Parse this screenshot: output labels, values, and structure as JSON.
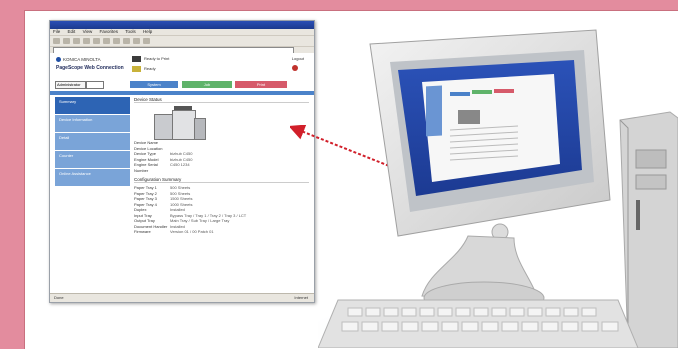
{
  "browser": {
    "window_title": "",
    "menu_items": [
      "File",
      "Edit",
      "View",
      "Favorites",
      "Tools",
      "Help"
    ],
    "address": "",
    "status_left": "Done",
    "status_right": "Internet"
  },
  "header": {
    "brand": "KONICA MINOLTA",
    "product": "PageScope Web Connection",
    "device_label_1": "Ready to Print",
    "device_label_2": "Ready",
    "top_right": "Logout"
  },
  "tabs": {
    "mode_select": "Administrator",
    "tab1": "System",
    "tab2": "Job",
    "tab3": "Print"
  },
  "sidebar": {
    "items": [
      {
        "label": "Summary"
      },
      {
        "label": "Device Information"
      },
      {
        "label": "Detail"
      },
      {
        "label": "Counter"
      },
      {
        "label": "Online Assistance"
      }
    ]
  },
  "main": {
    "title": "Device Status",
    "device_info": [
      {
        "k": "Device Name",
        "v": ""
      },
      {
        "k": "Device Location",
        "v": ""
      },
      {
        "k": "Device Type",
        "v": "bizhub C450"
      },
      {
        "k": "Engine Model",
        "v": "bizhub C450"
      },
      {
        "k": "Engine Serial Number",
        "v": "C450 1234"
      }
    ],
    "config_title": "Configuration Summary",
    "config": [
      {
        "k": "Paper Tray 1",
        "v": "500 Sheets"
      },
      {
        "k": "Paper Tray 2",
        "v": "500 Sheets"
      },
      {
        "k": "Paper Tray 3",
        "v": "1500 Sheets"
      },
      {
        "k": "Paper Tray 4",
        "v": "1000 Sheets"
      },
      {
        "k": "Duplex",
        "v": "Installed"
      },
      {
        "k": "Input Tray",
        "v": "Bypass Tray / Tray 1 / Tray 2 / Tray 3 / LCT"
      },
      {
        "k": "Output Tray",
        "v": "Main Tray / Sub Tray / Large Tray"
      },
      {
        "k": "Document Handler",
        "v": "Installed"
      },
      {
        "k": "Firmware",
        "v": "Version 01 / 00 Patch 01"
      }
    ]
  },
  "colors": {
    "frame_pink": "#e38c9e",
    "tab_blue": "#4b82c9",
    "tab_green": "#5fb36a",
    "tab_red": "#d65a6a",
    "arrow_red": "#d11f2a"
  }
}
